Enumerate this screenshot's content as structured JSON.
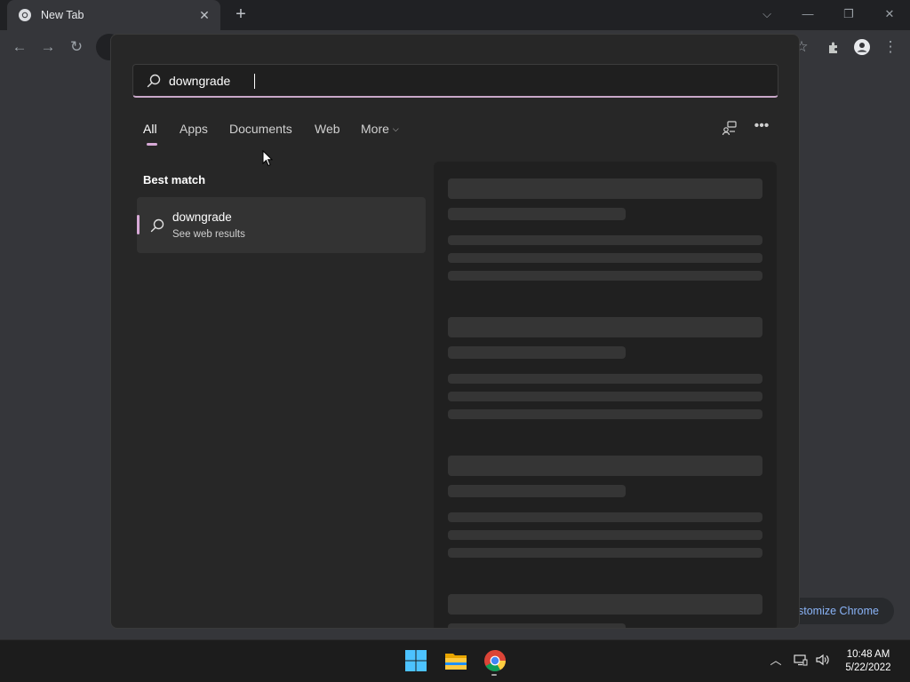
{
  "browser": {
    "tab_title": "New Tab",
    "tab_close": "✕",
    "new_tab": "+",
    "customize_chrome": "stomize Chrome"
  },
  "search": {
    "query": "downgrade",
    "tabs": [
      {
        "label": "All"
      },
      {
        "label": "Apps"
      },
      {
        "label": "Documents"
      },
      {
        "label": "Web"
      },
      {
        "label": "More"
      }
    ],
    "more_chevron": "⌵",
    "best_match_label": "Best match",
    "best_match": {
      "title": "downgrade",
      "subtitle": "See web results"
    },
    "accent_color": "#d7a9d6"
  },
  "taskbar": {
    "apps": [
      "start-icon",
      "file-explorer-icon",
      "chrome-icon"
    ],
    "time": "10:48 AM",
    "date": "5/22/2022"
  }
}
